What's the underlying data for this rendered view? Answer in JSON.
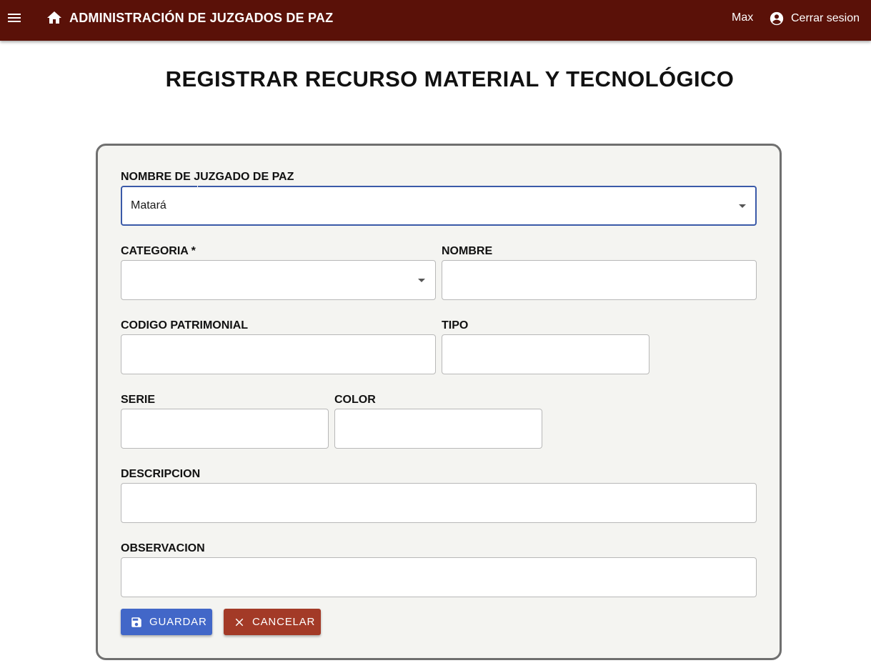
{
  "header": {
    "app_title": "ADMINISTRACIÓN DE JUZGADOS DE PAZ",
    "user_name": "Max",
    "logout_label": "Cerrar sesion",
    "bar_color": "#5a1108"
  },
  "page": {
    "title": "REGISTRAR RECURSO MATERIAL Y TECNOLÓGICO"
  },
  "form": {
    "juzgado": {
      "label": "NOMBRE DE JUZGADO DE PAZ",
      "value": "Matará"
    },
    "categoria": {
      "label": "CATEGORIA *",
      "value": ""
    },
    "nombre": {
      "label": "NOMBRE",
      "value": ""
    },
    "codigo_patrimonial": {
      "label": "CODIGO PATRIMONIAL",
      "value": ""
    },
    "tipo": {
      "label": "TIPO",
      "value": ""
    },
    "serie": {
      "label": "SERIE",
      "value": ""
    },
    "color": {
      "label": "COLOR",
      "value": ""
    },
    "descripcion": {
      "label": "DESCRIPCION",
      "value": ""
    },
    "observacion": {
      "label": "OBSERVACION",
      "value": ""
    }
  },
  "actions": {
    "save_label": "GUARDAR",
    "cancel_label": "CANCELAR",
    "save_color": "#4267c8",
    "cancel_color": "#a33a27"
  },
  "icons": {
    "menu": "menu-icon",
    "home": "home-icon",
    "account": "account-circle-icon",
    "save": "floppy-disk-icon",
    "cancel": "close-icon"
  }
}
